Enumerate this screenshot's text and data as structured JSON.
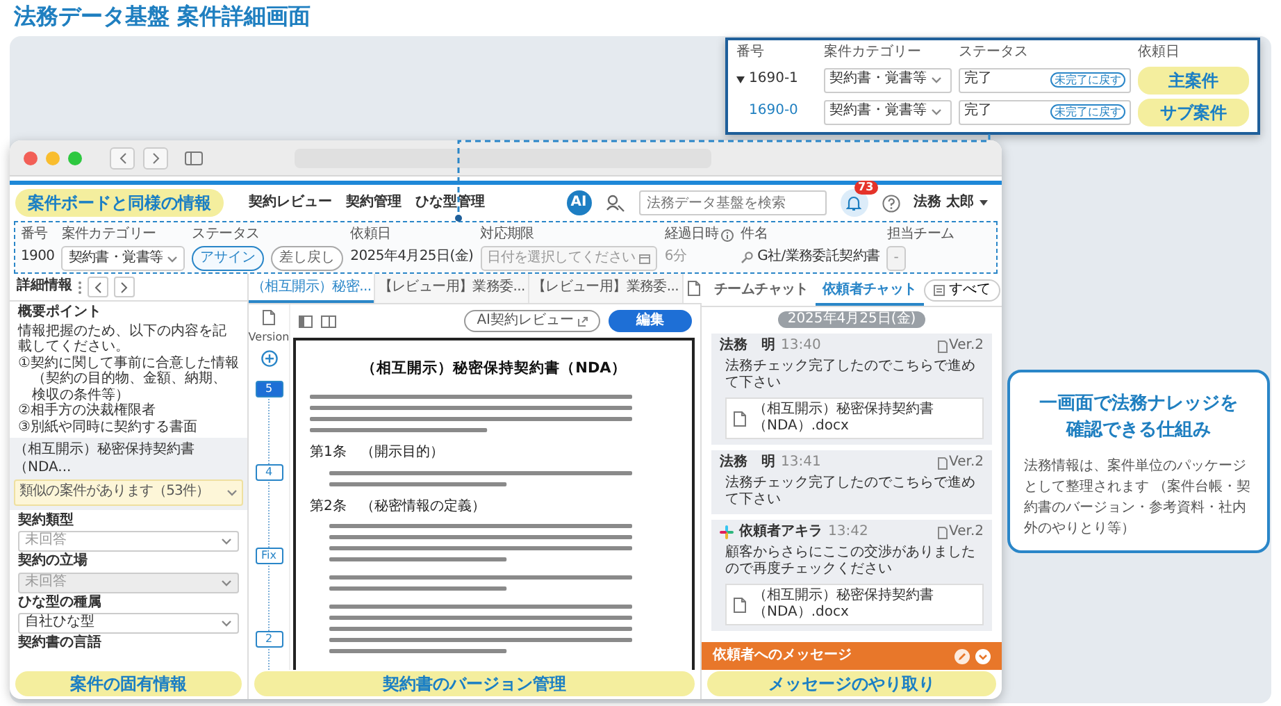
{
  "page_title": "法務データ基盤 案件詳細画面",
  "case_board": {
    "columns": [
      "番号",
      "案件カテゴリー",
      "ステータス",
      "依頼日"
    ],
    "rows": [
      {
        "kind": "parent",
        "number": "1690-1",
        "category": "契約書・覚書等",
        "status": "完了",
        "status_action": "未完了に戻す",
        "tag": "主案件"
      },
      {
        "kind": "child",
        "number": "1690-0",
        "category": "契約書・覚書等",
        "status": "完了",
        "status_action": "未完了に戻す",
        "tag": "サブ案件"
      }
    ]
  },
  "app": {
    "nav": [
      "契約レビュー",
      "契約管理",
      "ひな型管理"
    ],
    "ai_badge": "AI",
    "search": {
      "placeholder": "法務データ基盤を検索"
    },
    "notification_count": "73",
    "user": "法務 太郎",
    "case_info": [
      {
        "kind": "text",
        "label": "番号",
        "value": "1900",
        "info": false
      },
      {
        "kind": "select",
        "label": "案件カテゴリー",
        "value": "契約書・覚書等",
        "info": false
      },
      {
        "kind": "buttons",
        "label": "ステータス",
        "info": false,
        "options": [
          {
            "label": "アサイン",
            "selected": true
          },
          {
            "label": "差し戻し",
            "selected": false
          }
        ]
      },
      {
        "kind": "text",
        "label": "依頼日",
        "value": "2025年4月25日(金)",
        "info": false
      },
      {
        "kind": "date",
        "label": "対応期限",
        "placeholder": "日付を選択してください",
        "info": false
      },
      {
        "kind": "muted",
        "label": "経過日時",
        "value": "6分",
        "info": true
      },
      {
        "kind": "link",
        "label": "件名",
        "value": "G社/業務委託契約書",
        "info": false
      },
      {
        "kind": "box",
        "label": "担当チーム",
        "value": "-",
        "info": false
      }
    ],
    "detail": {
      "title": "詳細情報",
      "summary_label": "概要ポイント",
      "summary_lines": [
        "情報把握のため、以下の内容を記載してください。",
        "①契約に関して事前に合意した情報（契約の目的物、金額、納期、検収の条件等）",
        "②相手方の決裁権限者",
        "③別紙や同時に契約する書面"
      ],
      "contract_title": "（相互開示）秘密保持契約書（NDA...",
      "alert": "類似の案件があります（53件）",
      "fields": [
        {
          "label": "契約類型",
          "placeholder": "未回答",
          "disabled": false
        },
        {
          "label": "契約の立場",
          "placeholder": "未回答",
          "disabled": true
        },
        {
          "label": "ひな型の種属",
          "value": "自社ひな型",
          "disabled": false
        },
        {
          "label": "契約書の言語",
          "disabled": false
        }
      ]
    },
    "doc_tabs": [
      {
        "label": "（相互開示）秘密...",
        "selected": true
      },
      {
        "label": "【レビュー用】業務委...",
        "selected": false
      },
      {
        "label": "【レビュー用】業務委...",
        "selected": false
      }
    ],
    "versions": {
      "label": "Version",
      "items": [
        {
          "label": "5",
          "selected": true
        },
        {
          "label": "4",
          "selected": false
        },
        {
          "label": "Fix",
          "selected": false
        },
        {
          "label": "2",
          "selected": false
        }
      ]
    },
    "ai_review": "AI契約レビュー",
    "edit": "編集",
    "document": {
      "title": "（相互開示）秘密保持契約書（NDA）",
      "headings": [
        "第1条　（開示目的）",
        "第2条　（秘密情報の定義）"
      ]
    },
    "chat": {
      "tabs": [
        {
          "label": "チームチャット",
          "selected": false
        },
        {
          "label": "依頼者チャット",
          "selected": true
        }
      ],
      "filter": "すべて",
      "date": "2025年4月25日(金)",
      "messages": [
        {
          "kind": "staff",
          "author": "法務　明",
          "time": "13:40",
          "version": "Ver.2",
          "text": "法務チェック完了したのでこちらで進めて下さい",
          "attachment": "（相互開示）秘密保持契約書（NDA）.docx"
        },
        {
          "kind": "staff",
          "author": "法務　明",
          "time": "13:41",
          "version": "Ver.2",
          "text": "法務チェック完了したのでこちらで進めて下さい"
        },
        {
          "kind": "requester",
          "author": "依頼者アキラ",
          "time": "13:42",
          "version": "Ver.2",
          "text": "顧客からさらにここの交渉がありましたので再度チェックください",
          "attachment": "（相互開示）秘密保持契約書（NDA）.docx"
        }
      ],
      "composer": "依頼者へのメッセージ"
    }
  },
  "callouts": [
    "案件ボードと同様の情報",
    "案件の固有情報",
    "契約書のバージョン管理",
    "メッセージのやり取り"
  ],
  "explanation": {
    "title_lines": [
      "一画面で法務ナレッジを",
      "確認できる仕組み"
    ],
    "body": "法務情報は、案件単位のパッケージとして整理されます （案件台帳・契約書のバージョン・参考資料・社内外のやりとり等）"
  }
}
